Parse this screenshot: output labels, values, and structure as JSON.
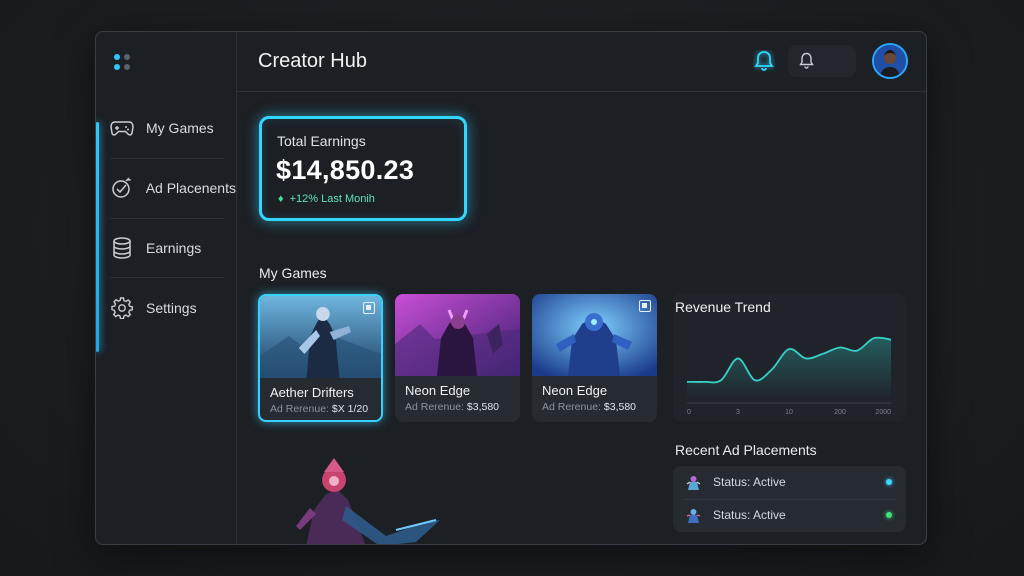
{
  "header": {
    "title": "Creator Hub"
  },
  "sidebar": {
    "items": [
      {
        "label": "My Games",
        "icon": "gamepad-icon"
      },
      {
        "label": "Ad Placenents",
        "icon": "target-icon"
      },
      {
        "label": "Earnings",
        "icon": "coins-icon"
      },
      {
        "label": "Settings",
        "icon": "gear-icon"
      }
    ]
  },
  "earnings": {
    "label": "Total Earnings",
    "value": "$14,850.23",
    "delta": "+12% Last Monih"
  },
  "my_games": {
    "title": "My Games",
    "games": [
      {
        "name": "Aether Drifters",
        "rev_label": "Ad Rerenue:",
        "rev_value": "$X 1/20"
      },
      {
        "name": "Neon Edge",
        "rev_label": "Ad Rerenue:",
        "rev_value": "$3,580"
      },
      {
        "name": "Neon Edge",
        "rev_label": "Ad Rerenue:",
        "rev_value": "$3,580"
      }
    ]
  },
  "revenue_trend": {
    "title": "Revenue Trend"
  },
  "recent_ads": {
    "title": "Recent Ad Placements",
    "items": [
      {
        "status": "Status: Active",
        "dot_color": "#3ad7ff"
      },
      {
        "status": "Status: Active",
        "dot_color": "#3de07a"
      }
    ]
  },
  "colors": {
    "accent": "#33d6ff",
    "positive": "#3fe0a0"
  },
  "chart_data": {
    "type": "area",
    "title": "Revenue Trend",
    "x_tick_labels": [
      "0",
      "3",
      "10",
      "200",
      "2000"
    ],
    "x": [
      0,
      1,
      2,
      3,
      4,
      5,
      6,
      7,
      8,
      9,
      10,
      11,
      12
    ],
    "values": [
      22,
      22,
      24,
      52,
      24,
      38,
      64,
      52,
      58,
      66,
      62,
      78,
      76
    ],
    "ylim": [
      0,
      100
    ],
    "grid": false,
    "legend": "none"
  }
}
